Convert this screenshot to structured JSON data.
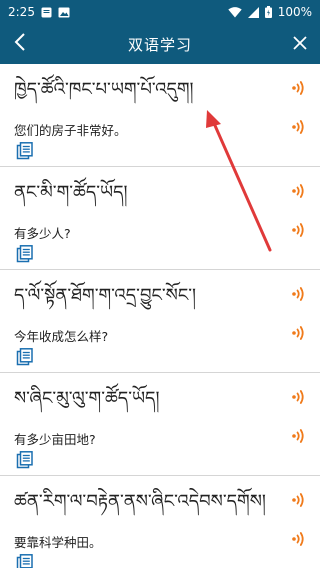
{
  "status_bar": {
    "time": "2:25",
    "battery": "100%"
  },
  "header": {
    "title": "双语学习"
  },
  "items": [
    {
      "tibetan": "ཁྱེད་ཚོའི་ཁང་པ་ཡག་པོ་འདུག།",
      "chinese": "您们的房子非常好。"
    },
    {
      "tibetan": "ནང་མི་ག་ཚོད་ཡོད།",
      "chinese": "有多少人?"
    },
    {
      "tibetan": "ད་ལོ་སྟོན་ཐོག་ག་འདྲ་བྱུང་སོང་།",
      "chinese": "今年收成怎么样?"
    },
    {
      "tibetan": "ས་ཞིང་མུ་ལུ་ག་ཚོད་ཡོད།",
      "chinese": "有多少亩田地?"
    },
    {
      "tibetan": "ཚན་རིག་ལ་བརྟེན་ནས་ཞིང་འདེབས་དགོས།",
      "chinese": "要靠科学种田。"
    }
  ],
  "colors": {
    "header_bg": "#0f5a7d",
    "speaker": "#f07a1a",
    "copy_icon": "#1a6fb0",
    "annotation_arrow": "#e03a3a"
  },
  "icons": {
    "back": "chevron-left-icon",
    "close": "close-icon",
    "speaker": "speaker-sound-icon",
    "copy": "copy-document-icon"
  }
}
